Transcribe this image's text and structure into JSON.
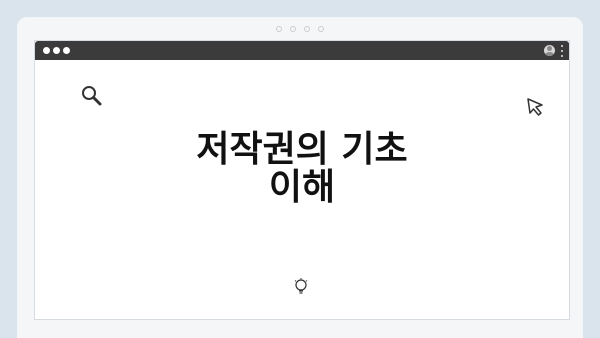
{
  "page": {
    "title_lines": [
      "저작권의 기초",
      "이해"
    ]
  },
  "icons": {
    "search": "search-icon",
    "cursor": "cursor-icon",
    "bulb": "lightbulb-icon",
    "user": "user-icon",
    "menu": "kebab-menu-icon"
  },
  "colors": {
    "background": "#d9e4ec",
    "card": "#f5f6f7",
    "titlebar": "#3b3b3b",
    "window": "#ffffff",
    "text": "#111111"
  }
}
